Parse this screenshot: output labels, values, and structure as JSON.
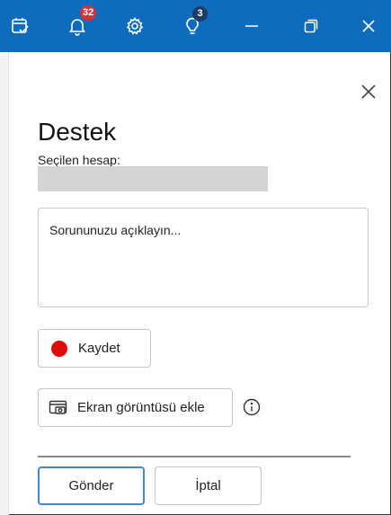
{
  "titlebar": {
    "color": "#0f6cbd",
    "notifications_count": "32",
    "tips_count": "3",
    "icons": [
      "calendar-check-icon",
      "bell-icon",
      "gear-icon",
      "lightbulb-icon",
      "minimize-icon",
      "restore-icon",
      "close-icon"
    ]
  },
  "panel": {
    "title": "Destek",
    "account_label": "Seçilen hesap:",
    "description_placeholder": "Sorununuzu açıklayın...",
    "record_label": "Kaydet",
    "screenshot_label": "Ekran görüntüsü ekle",
    "send_label": "Gönder",
    "cancel_label": "İptal"
  }
}
